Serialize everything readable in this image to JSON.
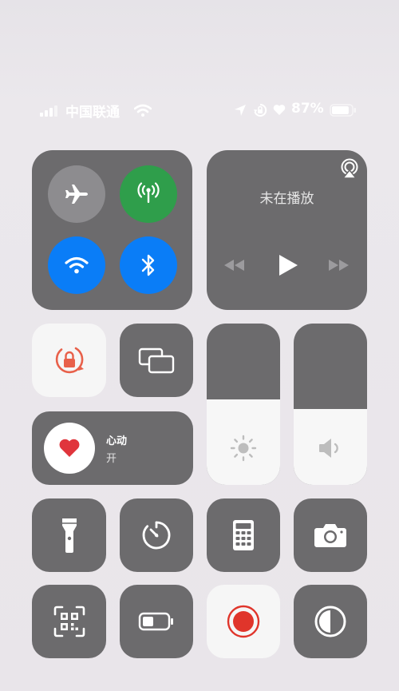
{
  "status_bar": {
    "carrier": "中国联通",
    "battery_percent": "87%",
    "battery_level": 0.87
  },
  "connectivity": {
    "airplane_mode": false,
    "cellular_data": true,
    "wifi": true,
    "bluetooth": true
  },
  "media": {
    "status": "未在播放"
  },
  "heart_widget": {
    "title": "心动",
    "state": "开"
  },
  "sliders": {
    "brightness_level": 0.53,
    "volume_level": 0.47
  },
  "colors": {
    "tile": "#6c6b6d",
    "wifi_bluetooth_on": "#0a7df7",
    "cellular_on": "#2f9e4b",
    "heart_red": "#e0353c",
    "rotation_lock_orange": "#e8604a",
    "record_red": "#e0352b"
  },
  "icons": [
    "signal-icon",
    "wifi-status-icon",
    "location-icon",
    "orientation-lock-status-icon",
    "heart-status-icon",
    "battery-icon",
    "airplane-icon",
    "antenna-icon",
    "wifi-icon",
    "bluetooth-icon",
    "airplay-icon",
    "rewind-icon",
    "play-icon",
    "fast-forward-icon",
    "rotation-lock-icon",
    "screen-mirroring-icon",
    "heart-icon",
    "brightness-icon",
    "volume-icon",
    "flashlight-icon",
    "timer-icon",
    "calculator-icon",
    "camera-icon",
    "qr-code-icon",
    "low-power-icon",
    "screen-record-icon",
    "dark-mode-icon"
  ]
}
